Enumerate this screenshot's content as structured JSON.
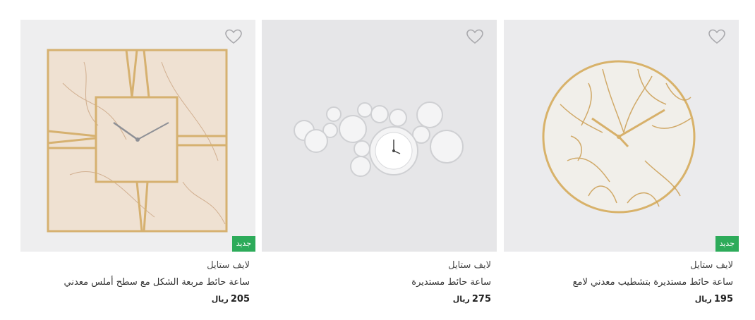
{
  "products": [
    {
      "brand": "لايف ستايل",
      "title": "ساعة حائط مربعة الشكل مع سطح أملس معدني",
      "price": "205",
      "currency": "ريال",
      "badge": "جديد"
    },
    {
      "brand": "لايف ستايل",
      "title": "ساعة حائط مستديرة",
      "price": "275",
      "currency": "ريال",
      "badge": ""
    },
    {
      "brand": "لايف ستايل",
      "title": "ساعة حائط مستديرة بتشطيب معدني لامع",
      "price": "195",
      "currency": "ريال",
      "badge": "جديد"
    }
  ],
  "icons": {
    "wishlist": "heart-outline-icon"
  },
  "colors": {
    "badge": "#2dab5a",
    "gold": "#d8b26a"
  }
}
